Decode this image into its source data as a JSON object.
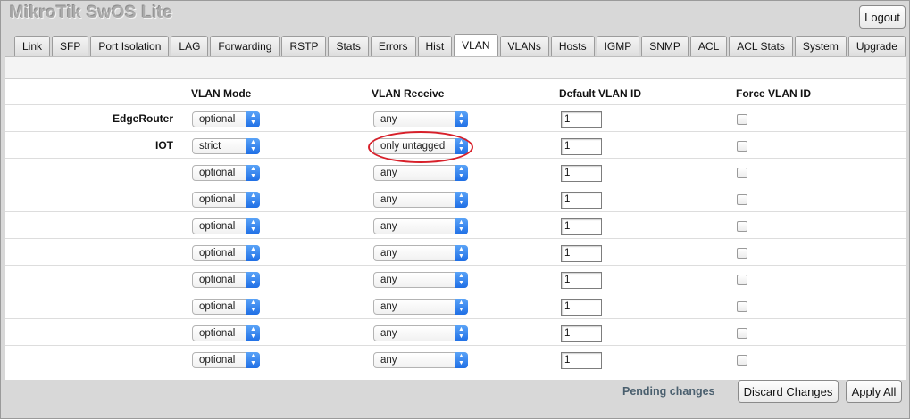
{
  "app": {
    "title": "MikroTik SwOS Lite",
    "logout_label": "Logout"
  },
  "tabs": [
    {
      "label": "Link"
    },
    {
      "label": "SFP"
    },
    {
      "label": "Port Isolation"
    },
    {
      "label": "LAG"
    },
    {
      "label": "Forwarding"
    },
    {
      "label": "RSTP"
    },
    {
      "label": "Stats"
    },
    {
      "label": "Errors"
    },
    {
      "label": "Hist"
    },
    {
      "label": "VLAN",
      "active": true
    },
    {
      "label": "VLANs"
    },
    {
      "label": "Hosts"
    },
    {
      "label": "IGMP"
    },
    {
      "label": "SNMP"
    },
    {
      "label": "ACL"
    },
    {
      "label": "ACL Stats"
    },
    {
      "label": "System"
    },
    {
      "label": "Upgrade"
    }
  ],
  "table": {
    "headers": {
      "vlan_mode": "VLAN Mode",
      "vlan_receive": "VLAN Receive",
      "default_vlan_id": "Default VLAN ID",
      "force_vlan_id": "Force VLAN ID"
    },
    "rows": [
      {
        "label": "EdgeRouter",
        "mode": "optional",
        "receive": "any",
        "default_id": "1",
        "force": false
      },
      {
        "label": "IOT",
        "mode": "strict",
        "receive": "only untagged",
        "default_id": "1",
        "force": false
      },
      {
        "label": "",
        "mode": "optional",
        "receive": "any",
        "default_id": "1",
        "force": false
      },
      {
        "label": "",
        "mode": "optional",
        "receive": "any",
        "default_id": "1",
        "force": false
      },
      {
        "label": "",
        "mode": "optional",
        "receive": "any",
        "default_id": "1",
        "force": false
      },
      {
        "label": "",
        "mode": "optional",
        "receive": "any",
        "default_id": "1",
        "force": false
      },
      {
        "label": "",
        "mode": "optional",
        "receive": "any",
        "default_id": "1",
        "force": false
      },
      {
        "label": "",
        "mode": "optional",
        "receive": "any",
        "default_id": "1",
        "force": false
      },
      {
        "label": "",
        "mode": "optional",
        "receive": "any",
        "default_id": "1",
        "force": false
      },
      {
        "label": "",
        "mode": "optional",
        "receive": "any",
        "default_id": "1",
        "force": false
      }
    ]
  },
  "footer": {
    "pending_text": "Pending changes",
    "discard_label": "Discard Changes",
    "apply_label": "Apply All"
  },
  "colors": {
    "highlight": "#d8202a",
    "select_arrow": "#1f6fe6",
    "pending_text": "#4a5f6e"
  }
}
